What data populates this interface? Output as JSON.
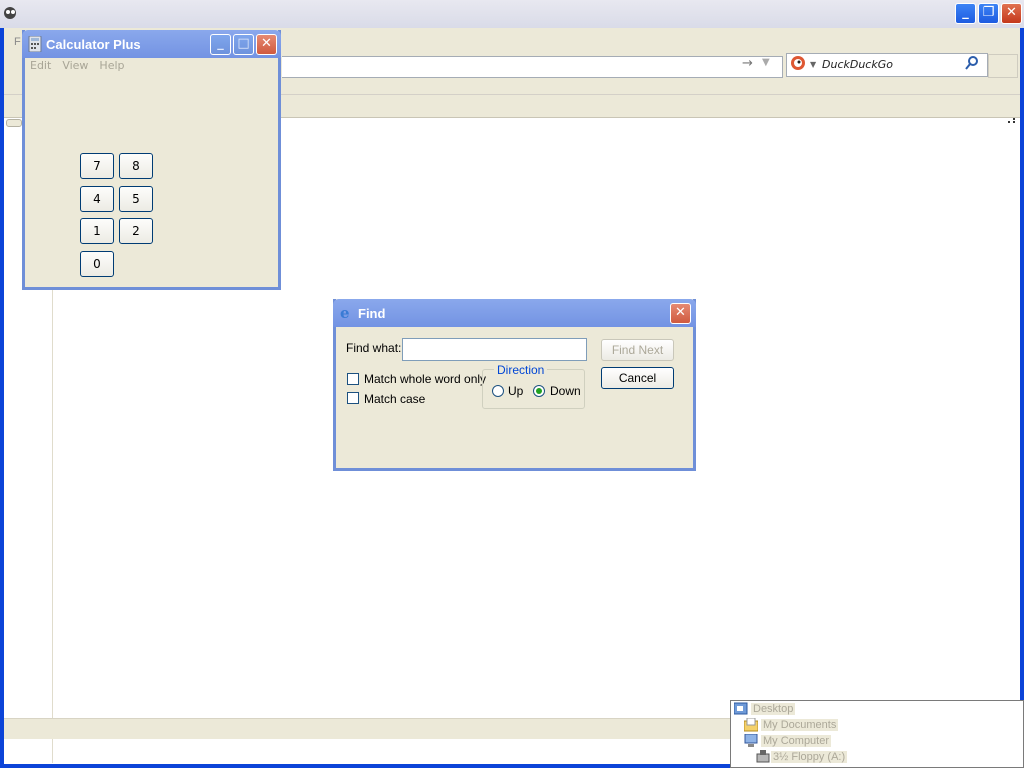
{
  "browser": {
    "menu_first_letter": "F",
    "search_engine": "DuckDuckGo"
  },
  "calculator": {
    "title": "Calculator Plus",
    "menu": [
      "Edit",
      "View",
      "Help"
    ],
    "keys": [
      "7",
      "8",
      "4",
      "5",
      "1",
      "2",
      "0"
    ]
  },
  "find_dialog": {
    "title": "Find",
    "find_what_label": "Find what:",
    "find_what_value": "",
    "find_next_label": "Find Next",
    "cancel_label": "Cancel",
    "match_whole_word_label": "Match whole word only",
    "match_case_label": "Match case",
    "direction_label": "Direction",
    "up_label": "Up",
    "down_label": "Down",
    "direction_selected": "Down"
  },
  "explorer_tree": {
    "items": [
      "Desktop",
      "My Documents",
      "My Computer",
      "3½ Floppy (A:)"
    ]
  },
  "colors": {
    "title_bar_active": "#0c44d8",
    "title_bar_inactive": "#7393e3",
    "dialog_background": "#ece9d8",
    "direction_group_label": "#0046d5"
  }
}
